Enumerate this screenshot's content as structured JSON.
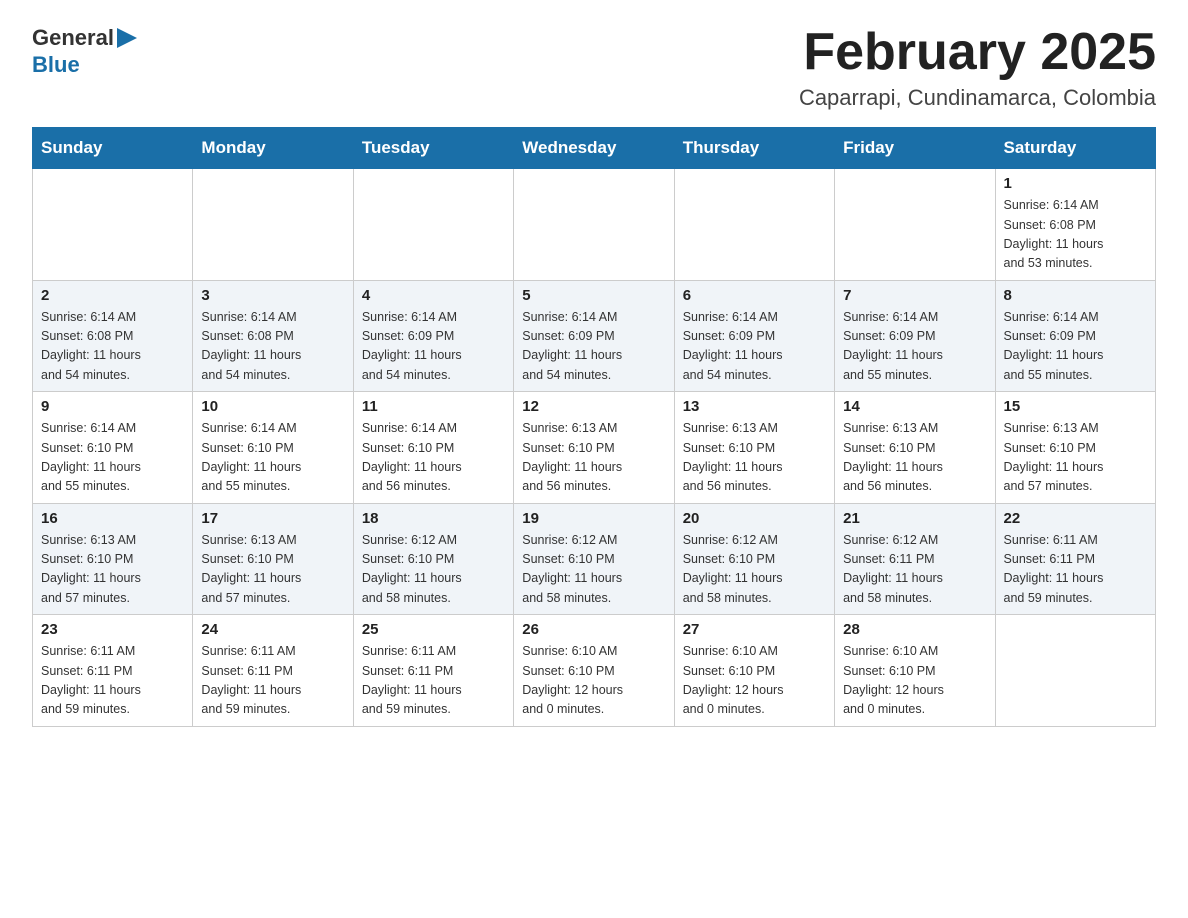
{
  "header": {
    "logo_general": "General",
    "logo_blue": "Blue",
    "month_title": "February 2025",
    "location": "Caparrapi, Cundinamarca, Colombia"
  },
  "weekdays": [
    "Sunday",
    "Monday",
    "Tuesday",
    "Wednesday",
    "Thursday",
    "Friday",
    "Saturday"
  ],
  "weeks": [
    {
      "days": [
        {
          "num": "",
          "info": ""
        },
        {
          "num": "",
          "info": ""
        },
        {
          "num": "",
          "info": ""
        },
        {
          "num": "",
          "info": ""
        },
        {
          "num": "",
          "info": ""
        },
        {
          "num": "",
          "info": ""
        },
        {
          "num": "1",
          "info": "Sunrise: 6:14 AM\nSunset: 6:08 PM\nDaylight: 11 hours\nand 53 minutes."
        }
      ]
    },
    {
      "days": [
        {
          "num": "2",
          "info": "Sunrise: 6:14 AM\nSunset: 6:08 PM\nDaylight: 11 hours\nand 54 minutes."
        },
        {
          "num": "3",
          "info": "Sunrise: 6:14 AM\nSunset: 6:08 PM\nDaylight: 11 hours\nand 54 minutes."
        },
        {
          "num": "4",
          "info": "Sunrise: 6:14 AM\nSunset: 6:09 PM\nDaylight: 11 hours\nand 54 minutes."
        },
        {
          "num": "5",
          "info": "Sunrise: 6:14 AM\nSunset: 6:09 PM\nDaylight: 11 hours\nand 54 minutes."
        },
        {
          "num": "6",
          "info": "Sunrise: 6:14 AM\nSunset: 6:09 PM\nDaylight: 11 hours\nand 54 minutes."
        },
        {
          "num": "7",
          "info": "Sunrise: 6:14 AM\nSunset: 6:09 PM\nDaylight: 11 hours\nand 55 minutes."
        },
        {
          "num": "8",
          "info": "Sunrise: 6:14 AM\nSunset: 6:09 PM\nDaylight: 11 hours\nand 55 minutes."
        }
      ]
    },
    {
      "days": [
        {
          "num": "9",
          "info": "Sunrise: 6:14 AM\nSunset: 6:10 PM\nDaylight: 11 hours\nand 55 minutes."
        },
        {
          "num": "10",
          "info": "Sunrise: 6:14 AM\nSunset: 6:10 PM\nDaylight: 11 hours\nand 55 minutes."
        },
        {
          "num": "11",
          "info": "Sunrise: 6:14 AM\nSunset: 6:10 PM\nDaylight: 11 hours\nand 56 minutes."
        },
        {
          "num": "12",
          "info": "Sunrise: 6:13 AM\nSunset: 6:10 PM\nDaylight: 11 hours\nand 56 minutes."
        },
        {
          "num": "13",
          "info": "Sunrise: 6:13 AM\nSunset: 6:10 PM\nDaylight: 11 hours\nand 56 minutes."
        },
        {
          "num": "14",
          "info": "Sunrise: 6:13 AM\nSunset: 6:10 PM\nDaylight: 11 hours\nand 56 minutes."
        },
        {
          "num": "15",
          "info": "Sunrise: 6:13 AM\nSunset: 6:10 PM\nDaylight: 11 hours\nand 57 minutes."
        }
      ]
    },
    {
      "days": [
        {
          "num": "16",
          "info": "Sunrise: 6:13 AM\nSunset: 6:10 PM\nDaylight: 11 hours\nand 57 minutes."
        },
        {
          "num": "17",
          "info": "Sunrise: 6:13 AM\nSunset: 6:10 PM\nDaylight: 11 hours\nand 57 minutes."
        },
        {
          "num": "18",
          "info": "Sunrise: 6:12 AM\nSunset: 6:10 PM\nDaylight: 11 hours\nand 58 minutes."
        },
        {
          "num": "19",
          "info": "Sunrise: 6:12 AM\nSunset: 6:10 PM\nDaylight: 11 hours\nand 58 minutes."
        },
        {
          "num": "20",
          "info": "Sunrise: 6:12 AM\nSunset: 6:10 PM\nDaylight: 11 hours\nand 58 minutes."
        },
        {
          "num": "21",
          "info": "Sunrise: 6:12 AM\nSunset: 6:11 PM\nDaylight: 11 hours\nand 58 minutes."
        },
        {
          "num": "22",
          "info": "Sunrise: 6:11 AM\nSunset: 6:11 PM\nDaylight: 11 hours\nand 59 minutes."
        }
      ]
    },
    {
      "days": [
        {
          "num": "23",
          "info": "Sunrise: 6:11 AM\nSunset: 6:11 PM\nDaylight: 11 hours\nand 59 minutes."
        },
        {
          "num": "24",
          "info": "Sunrise: 6:11 AM\nSunset: 6:11 PM\nDaylight: 11 hours\nand 59 minutes."
        },
        {
          "num": "25",
          "info": "Sunrise: 6:11 AM\nSunset: 6:11 PM\nDaylight: 11 hours\nand 59 minutes."
        },
        {
          "num": "26",
          "info": "Sunrise: 6:10 AM\nSunset: 6:10 PM\nDaylight: 12 hours\nand 0 minutes."
        },
        {
          "num": "27",
          "info": "Sunrise: 6:10 AM\nSunset: 6:10 PM\nDaylight: 12 hours\nand 0 minutes."
        },
        {
          "num": "28",
          "info": "Sunrise: 6:10 AM\nSunset: 6:10 PM\nDaylight: 12 hours\nand 0 minutes."
        },
        {
          "num": "",
          "info": ""
        }
      ]
    }
  ]
}
